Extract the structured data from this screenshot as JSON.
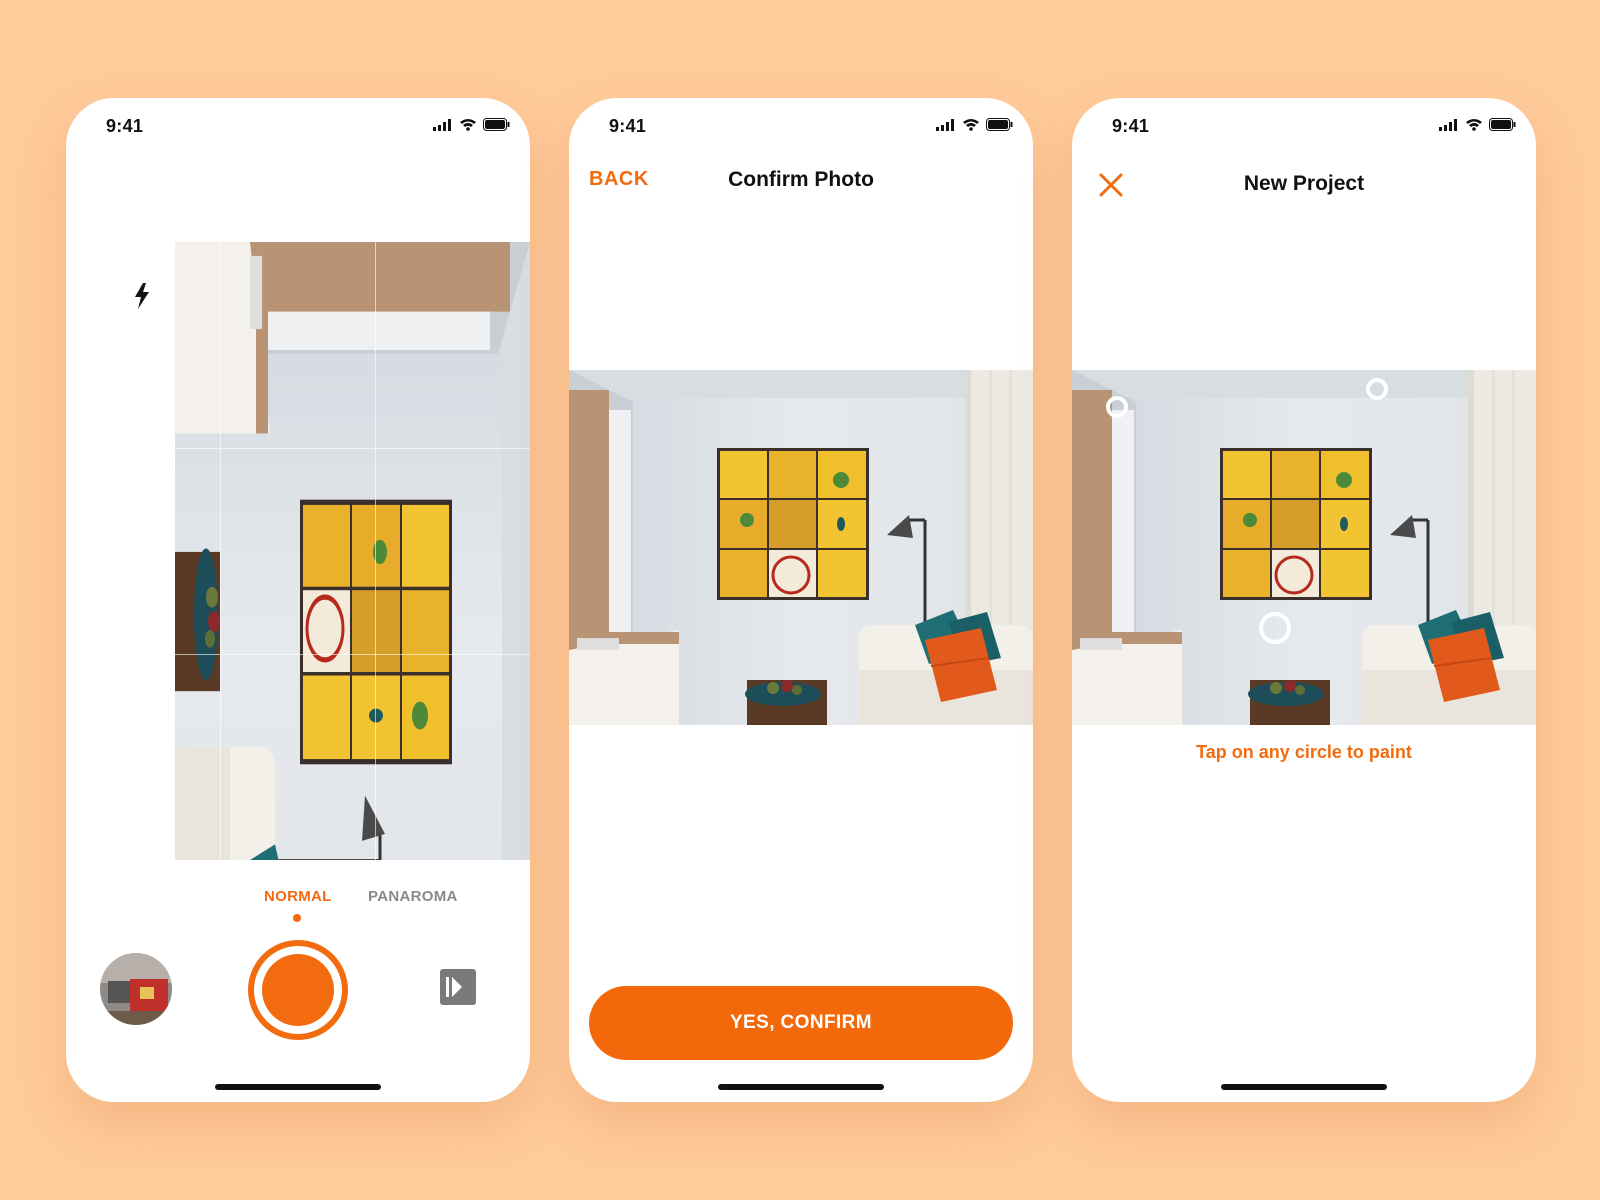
{
  "background_color": "#ffcb9b",
  "accent_color": "#f26b0f",
  "screens": [
    {
      "status": {
        "time": "9:41"
      },
      "toolbar": {
        "icons": [
          "flash-icon",
          "grid-icon",
          "gear-icon"
        ]
      },
      "modes": {
        "normal": "NORMAL",
        "panorama": "PANAROMA",
        "selected": "NORMAL"
      }
    },
    {
      "status": {
        "time": "9:41"
      },
      "nav": {
        "back_label": "BACK",
        "title": "Confirm Photo"
      },
      "confirm_label": "YES, CONFIRM"
    },
    {
      "status": {
        "time": "9:41"
      },
      "nav": {
        "title": "New Project",
        "close_icon": "close-icon"
      },
      "hint": "Tap on any circle to paint"
    }
  ]
}
